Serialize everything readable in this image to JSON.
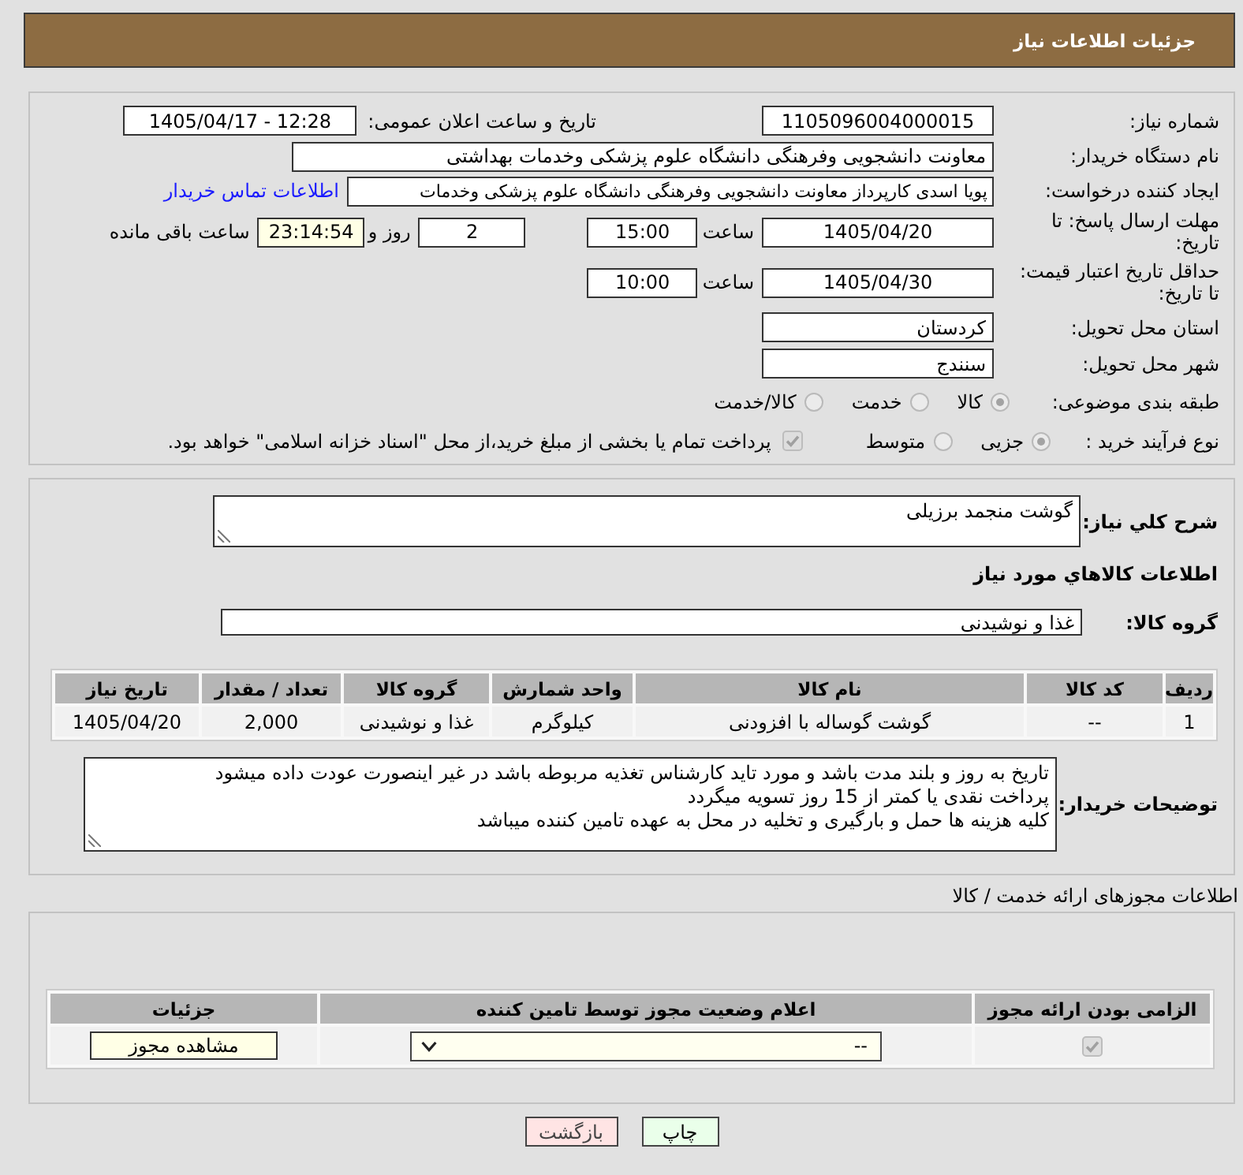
{
  "header": {
    "title": "جزئیات اطلاعات نیاز"
  },
  "details": {
    "need_number": {
      "label": "شماره نیاز:",
      "value": "1105096004000015"
    },
    "announcement": {
      "label": "تاریخ و ساعت اعلان عمومی:",
      "value": "1405/04/17 - 12:28"
    },
    "buyer_org": {
      "label": "نام دستگاه خریدار:",
      "value": "معاونت دانشجویی وفرهنگی دانشگاه علوم پزشکی وخدمات بهداشتی"
    },
    "requester": {
      "label": "ایجاد کننده درخواست:",
      "value": "پویا اسدی کارپرداز معاونت دانشجویی وفرهنگی دانشگاه علوم پزشکی وخدمات",
      "link": "اطلاعات تماس خریدار"
    },
    "response_deadline": {
      "label": "مهلت ارسال پاسخ: تا تاریخ:",
      "date": "1405/04/20",
      "time_label": "ساعت",
      "time": "15:00",
      "days": "2",
      "days_label": "روز و",
      "remaining": "23:14:54",
      "remaining_label": "ساعت باقی مانده"
    },
    "price_validity": {
      "label": "حداقل تاریخ اعتبار قیمت: تا تاریخ:",
      "date": "1405/04/30",
      "time_label": "ساعت",
      "time": "10:00"
    },
    "delivery_province": {
      "label": "استان محل تحویل:",
      "value": "کردستان"
    },
    "delivery_city": {
      "label": "شهر محل تحویل:",
      "value": "سنندج"
    },
    "category": {
      "label": "طبقه بندی موضوعی:",
      "options": [
        {
          "label": "کالا",
          "selected": true
        },
        {
          "label": "خدمت",
          "selected": false
        },
        {
          "label": "کالا/خدمت",
          "selected": false
        }
      ]
    },
    "purchase_process": {
      "label": "نوع فرآیند خرید :",
      "options": [
        {
          "label": "جزیی",
          "selected": true
        },
        {
          "label": "متوسط",
          "selected": false
        }
      ],
      "treasury_payment": {
        "label": "پرداخت تمام یا بخشی از مبلغ خرید،از محل \"اسناد خزانه اسلامی\" خواهد بود.",
        "checked": true
      }
    }
  },
  "goods": {
    "description": {
      "label": "شرح کلي نياز:",
      "value": "گوشت منجمد برزیلی"
    },
    "title": "اطلاعات کالاهاي مورد نياز",
    "group": {
      "label": "گروه کالا:",
      "value": "غذا و نوشیدنی"
    },
    "table": {
      "columns": [
        "ردیف",
        "کد کالا",
        "نام کالا",
        "واحد شمارش",
        "گروه کالا",
        "تعداد / مقدار",
        "تاریخ نیاز"
      ],
      "rows": [
        {
          "cells": [
            "1",
            "--",
            "گوشت گوساله با افزودنی",
            "کیلوگرم",
            "غذا و نوشیدنی",
            "2,000",
            "1405/04/20"
          ]
        }
      ]
    },
    "notes": {
      "label": "توضیحات خریدار:",
      "value": "تاریخ به روز و بلند مدت باشد و مورد تاید کارشناس تغذیه مربوطه باشد در غیر اینصورت عودت داده میشود\nپرداخت نقدی یا کمتر از 15 روز تسویه میگردد\nکلیه هزینه ها حمل و بارگیری و تخلیه در محل به عهده تامین کننده میباشد"
    }
  },
  "permits": {
    "title": "اطلاعات مجوزهای ارائه خدمت / کالا",
    "columns": [
      "الزامی بودن ارائه مجوز",
      "اعلام وضعیت مجوز توسط تامین کننده",
      "جزئیات"
    ],
    "rows": [
      {
        "required": true,
        "status": "--",
        "action": "مشاهده مجوز"
      }
    ]
  },
  "buttons": [
    {
      "label": "چاپ",
      "kind": "print"
    },
    {
      "label": "بازگشت",
      "kind": "back"
    }
  ]
}
